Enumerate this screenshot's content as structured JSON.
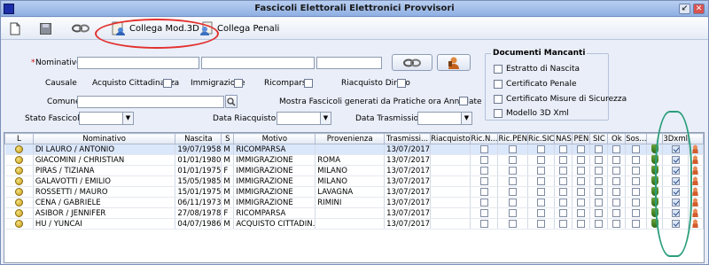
{
  "window": {
    "title": "Fascicoli Elettorali Elettronici Provvisori",
    "minimize": "↙",
    "close": "✕"
  },
  "toolbar": {
    "collega_mod3d": "Collega Mod.3D",
    "collega_penali": "Collega Penali",
    "icons": [
      "new-document-icon",
      "save-icon",
      "link-icon",
      "document-person-icon",
      "person-document-icon"
    ]
  },
  "form": {
    "nominativo_required": "*",
    "nominativo_label": "Nominativo",
    "causale_label": "Causale",
    "acquisto_cittadinanza": "Acquisto Cittadinanza",
    "immigrazione": "Immigrazione",
    "ricomparsa": "Ricomparsa",
    "riacquisto_diritto": "Riacquisto Diritto",
    "comune_label": "Comune",
    "mostra_fascicoli": "Mostra Fascicoli generati da Pratiche ora Annullate",
    "stato_fascicolo_label": "Stato Fascicolo",
    "data_riacquisto_label": "Data Riacquisto",
    "data_trasmissione_label": "Data Trasmissione"
  },
  "documenti_mancanti": {
    "title": "Documenti Mancanti",
    "items": [
      "Estratto di Nascita",
      "Certificato Penale",
      "Certificato Misure di Sicurezza",
      "Modello 3D Xml"
    ]
  },
  "grid": {
    "columns": [
      "L",
      "Nominativo",
      "Nascita",
      "S",
      "Motivo",
      "Provenienza",
      "Trasmissi...",
      "Riacquisto",
      "Ric.N...",
      "Ric.PEN",
      "Ric.SIC",
      "NAS",
      "PEN",
      "SIC",
      "Ok",
      "Sos...",
      "",
      "3Dxml",
      ""
    ],
    "rows": [
      {
        "nominativo": "DI LAURO / ANTONIO",
        "nascita": "19/07/1958",
        "s": "M",
        "motivo": "RICOMPARSA",
        "provenienza": "",
        "trasmissione": "13/07/2017",
        "riacquisto": ""
      },
      {
        "nominativo": "GIACOMINI / CHRISTIAN",
        "nascita": "01/01/1980",
        "s": "M",
        "motivo": "IMMIGRAZIONE",
        "provenienza": "ROMA",
        "trasmissione": "13/07/2017",
        "riacquisto": ""
      },
      {
        "nominativo": "PIRAS / TIZIANA",
        "nascita": "01/01/1975",
        "s": "F",
        "motivo": "IMMIGRAZIONE",
        "provenienza": "MILANO",
        "trasmissione": "13/07/2017",
        "riacquisto": ""
      },
      {
        "nominativo": "GALAVOTTI / EMILIO",
        "nascita": "15/05/1985",
        "s": "M",
        "motivo": "IMMIGRAZIONE",
        "provenienza": "MILANO",
        "trasmissione": "13/07/2017",
        "riacquisto": ""
      },
      {
        "nominativo": "ROSSETTI / MAURO",
        "nascita": "15/01/1975",
        "s": "M",
        "motivo": "IMMIGRAZIONE",
        "provenienza": "LAVAGNA",
        "trasmissione": "13/07/2017",
        "riacquisto": ""
      },
      {
        "nominativo": "CENA / GABRIELE",
        "nascita": "06/11/1973",
        "s": "M",
        "motivo": "IMMIGRAZIONE",
        "provenienza": "RIMINI",
        "trasmissione": "13/07/2017",
        "riacquisto": ""
      },
      {
        "nominativo": "ASIBOR / JENNIFER",
        "nascita": "27/08/1978",
        "s": "F",
        "motivo": "RICOMPARSA",
        "provenienza": "",
        "trasmissione": "13/07/2017",
        "riacquisto": ""
      },
      {
        "nominativo": "HU / YUNCAI",
        "nascita": "04/07/1986",
        "s": "M",
        "motivo": "ACQUISTO CITTADIN.",
        "provenienza": "",
        "trasmissione": "13/07/2017",
        "riacquisto": ""
      }
    ]
  },
  "colors": {
    "highlight_ring": "#e3302e",
    "annotation_ring": "#2c9e7c",
    "title_gradient": "#8fb0e3"
  }
}
